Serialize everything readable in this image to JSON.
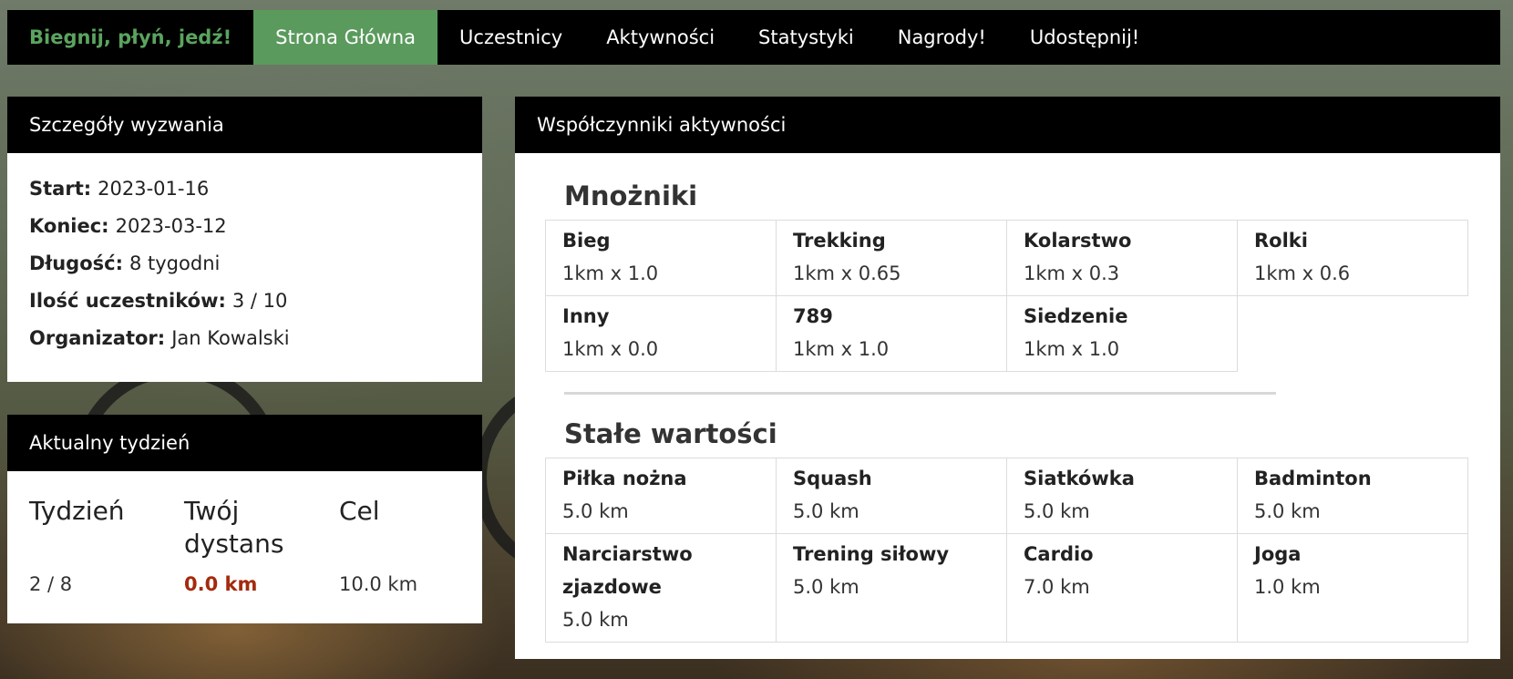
{
  "nav": {
    "brand": "Biegnij, płyń, jedź!",
    "items": [
      "Strona Główna",
      "Uczestnicy",
      "Aktywności",
      "Statystyki",
      "Nagrody!",
      "Udostępnij!"
    ],
    "active_index": 0
  },
  "challenge": {
    "title": "Szczegóły wyzwania",
    "start_label": "Start:",
    "start_value": "2023-01-16",
    "end_label": "Koniec:",
    "end_value": "2023-03-12",
    "length_label": "Długość:",
    "length_value": "8 tygodni",
    "participants_label": "Ilość uczestników:",
    "participants_value": "3 / 10",
    "organizer_label": "Organizator:",
    "organizer_value": "Jan Kowalski"
  },
  "week": {
    "title": "Aktualny tydzień",
    "headers": [
      "Tydzień",
      "Twój dystans",
      "Cel"
    ],
    "values": [
      "2 / 8",
      "0.0 km",
      "10.0 km"
    ]
  },
  "coefficients": {
    "title": "Współczynniki aktywności",
    "multipliers_title": "Mnożniki",
    "multipliers": [
      {
        "name": "Bieg",
        "value": "1km x 1.0"
      },
      {
        "name": "Trekking",
        "value": "1km x 0.65"
      },
      {
        "name": "Kolarstwo",
        "value": "1km x 0.3"
      },
      {
        "name": "Rolki",
        "value": "1km x 0.6"
      },
      {
        "name": "Inny",
        "value": "1km x 0.0"
      },
      {
        "name": "789",
        "value": "1km x 1.0"
      },
      {
        "name": "Siedzenie",
        "value": "1km x 1.0"
      }
    ],
    "constants_title": "Stałe wartości",
    "constants": [
      {
        "name": "Piłka nożna",
        "value": "5.0 km"
      },
      {
        "name": "Squash",
        "value": "5.0 km"
      },
      {
        "name": "Siatkówka",
        "value": "5.0 km"
      },
      {
        "name": "Badminton",
        "value": "5.0 km"
      },
      {
        "name": "Narciarstwo zjazdowe",
        "value": "5.0 km"
      },
      {
        "name": "Trening siłowy",
        "value": "5.0 km"
      },
      {
        "name": "Cardio",
        "value": "7.0 km"
      },
      {
        "name": "Joga",
        "value": "1.0 km"
      }
    ]
  }
}
